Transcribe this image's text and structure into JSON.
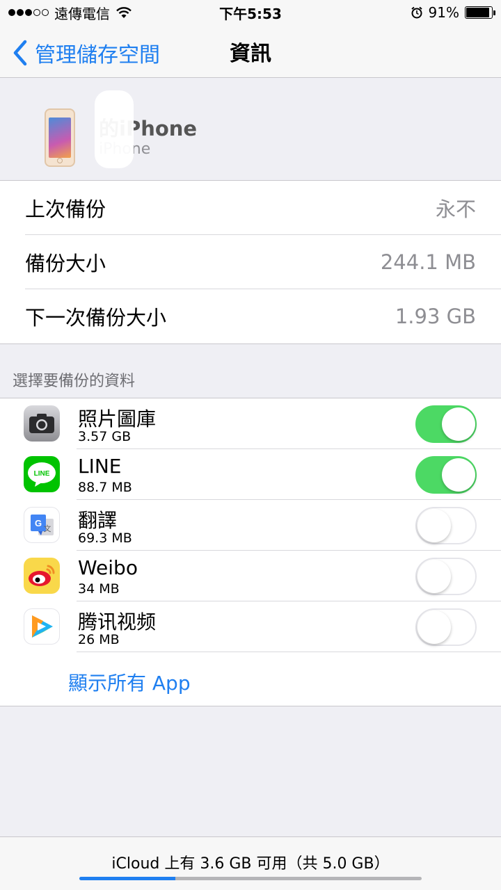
{
  "status_bar": {
    "carrier": "遠傳電信",
    "time": "下午5:53",
    "battery_percent": "91%",
    "battery_level": 0.91,
    "signal_bars_filled": 3,
    "signal_bars_total": 5
  },
  "nav": {
    "back_label": "管理儲存空間",
    "title": "資訊"
  },
  "device": {
    "name": "的iPhone",
    "model": "iPhone"
  },
  "backup_info": [
    {
      "label": "上次備份",
      "value": "永不"
    },
    {
      "label": "備份大小",
      "value": "244.1 MB"
    },
    {
      "label": "下一次備份大小",
      "value": "1.93 GB"
    }
  ],
  "section_header": "選擇要備份的資料",
  "apps": [
    {
      "name": "照片圖庫",
      "size": "3.57 GB",
      "enabled": true,
      "icon": "camera-icon"
    },
    {
      "name": "LINE",
      "size": "88.7 MB",
      "enabled": true,
      "icon": "line-icon"
    },
    {
      "name": "翻譯",
      "size": "69.3 MB",
      "enabled": false,
      "icon": "translate-icon"
    },
    {
      "name": "Weibo",
      "size": "34 MB",
      "enabled": false,
      "icon": "weibo-icon"
    },
    {
      "name": "腾讯视频",
      "size": "26 MB",
      "enabled": false,
      "icon": "tencent-video-icon"
    }
  ],
  "line_icon_text": "LINE",
  "show_all_label": "顯示所有 App",
  "footer": {
    "text": "iCloud 上有 3.6 GB 可用（共 5.0 GB）",
    "used_fraction": 0.28
  },
  "colors": {
    "accent": "#1f7ff0",
    "toggle_on": "#4cd964",
    "background": "#efeff4"
  }
}
